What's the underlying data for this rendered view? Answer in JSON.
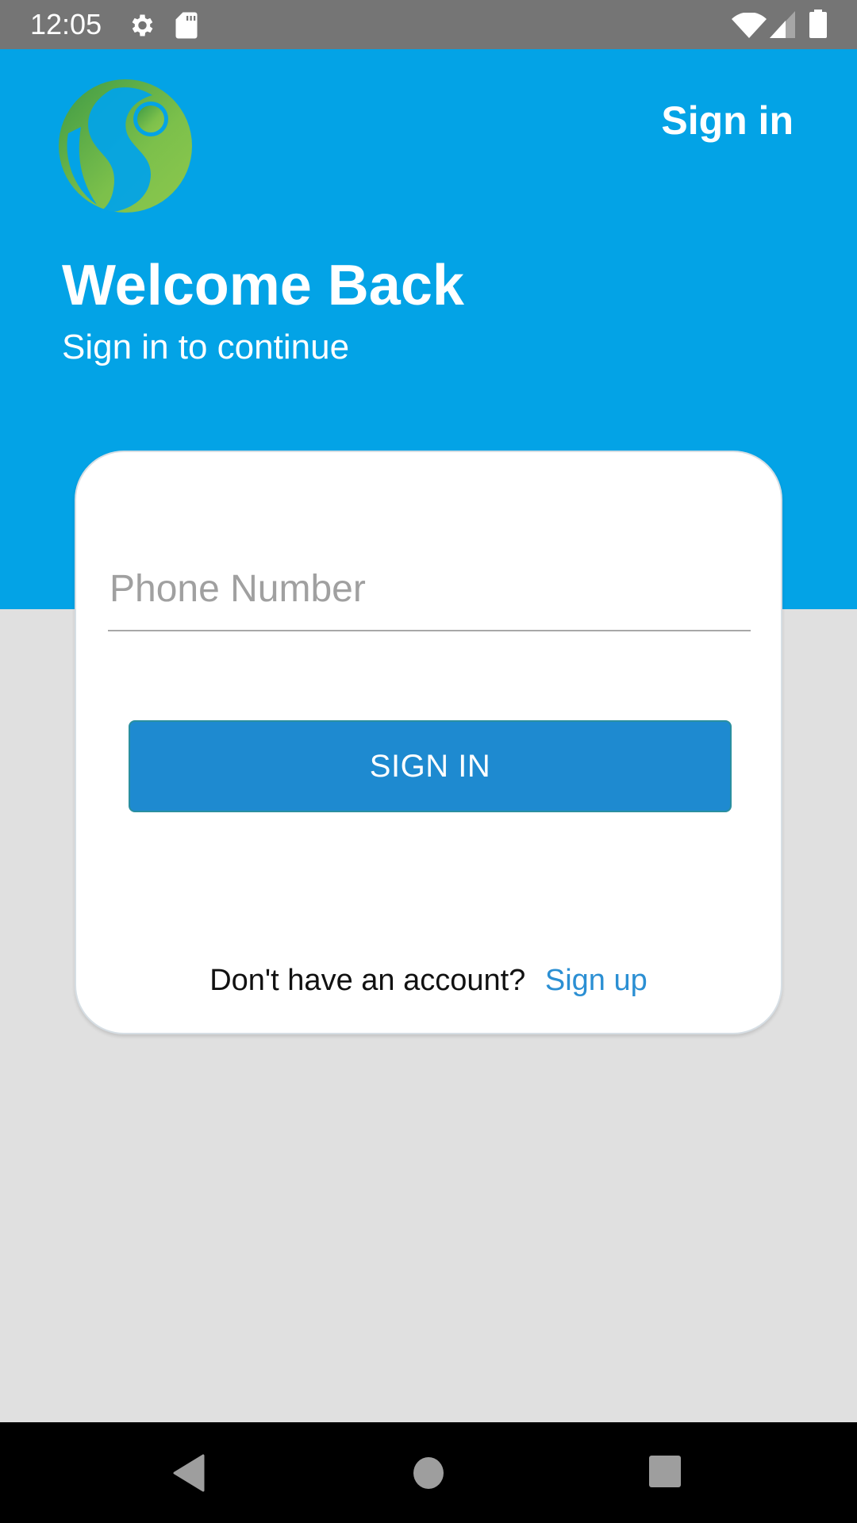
{
  "status_bar": {
    "time": "12:05",
    "left_icons": [
      "gear-icon",
      "sd-card-icon"
    ],
    "right_icons": [
      "wifi-icon",
      "cell-signal-icon",
      "battery-icon"
    ]
  },
  "header": {
    "logo": "app-logo",
    "signin_label": "Sign in",
    "title": "Welcome Back",
    "subtitle": "Sign in to continue",
    "background_color": "#03A3E6"
  },
  "login_card": {
    "phone_field": {
      "value": "",
      "placeholder": "Phone Number"
    },
    "signin_button_label": "SIGN IN",
    "button_color": "#1E8AD0",
    "signup_prompt": "Don't have an account?",
    "signup_link": "Sign up",
    "link_color": "#2B8FD3"
  },
  "nav_bar": {
    "buttons": [
      "back",
      "home",
      "recents"
    ]
  }
}
